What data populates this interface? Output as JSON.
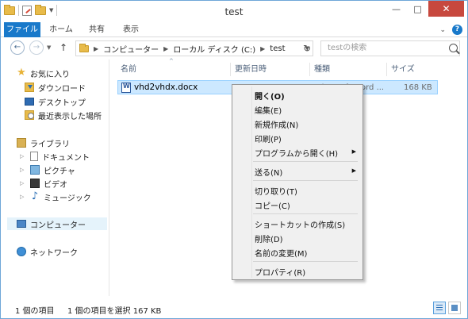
{
  "window": {
    "title": "test"
  },
  "ribbon": {
    "tabs": [
      {
        "label": "ファイル"
      },
      {
        "label": "ホーム"
      },
      {
        "label": "共有"
      },
      {
        "label": "表示"
      }
    ],
    "accent": "#1979ca"
  },
  "address": {
    "crumbs": [
      "コンピューター",
      "ローカル ディスク (C:)",
      "test"
    ]
  },
  "search": {
    "placeholder": "testの検索"
  },
  "nav": {
    "favorites": {
      "label": "お気に入り",
      "items": [
        "ダウンロード",
        "デスクトップ",
        "最近表示した場所"
      ]
    },
    "libraries": {
      "label": "ライブラリ",
      "items": [
        "ドキュメント",
        "ピクチャ",
        "ビデオ",
        "ミュージック"
      ]
    },
    "computer": {
      "label": "コンピューター"
    },
    "network": {
      "label": "ネットワーク"
    }
  },
  "columns": {
    "name": "名前",
    "date": "更新日時",
    "type": "種類",
    "size": "サイズ"
  },
  "file": {
    "name": "vhd2vhdx.docx",
    "type": "Microsoft Word ...",
    "size": "168 KB"
  },
  "context_menu": {
    "open": "開く(O)",
    "edit": "編集(E)",
    "new": "新規作成(N)",
    "print": "印刷(P)",
    "open_with": "プログラムから開く(H)",
    "send_to": "送る(N)",
    "cut": "切り取り(T)",
    "copy": "コピー(C)",
    "create_shortcut": "ショートカットの作成(S)",
    "delete": "削除(D)",
    "rename": "名前の変更(M)",
    "properties": "プロパティ(R)"
  },
  "status": {
    "count": "1 個の項目",
    "selection": "1 個の項目を選択  167 KB"
  }
}
